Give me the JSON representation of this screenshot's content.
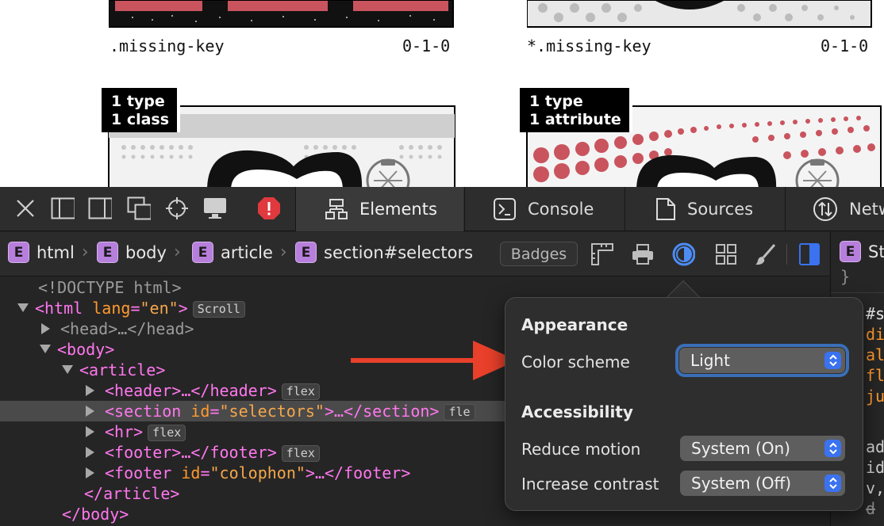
{
  "page": {
    "card1_label": ".missing-key",
    "card1_score": "0-1-0",
    "card2_label": "*.missing-key",
    "card2_score": "0-1-0",
    "card3_badge_line1": "1 type",
    "card3_badge_line2": "1 class",
    "card4_badge_line1": "1 type",
    "card4_badge_line2": "1 attribute"
  },
  "toolbar": {
    "tabs": [
      {
        "label": "Elements",
        "icon": "elements-icon"
      },
      {
        "label": "Console",
        "icon": "console-icon"
      },
      {
        "label": "Sources",
        "icon": "sources-icon"
      },
      {
        "label": "Netw",
        "icon": "network-icon"
      }
    ]
  },
  "breadcrumb": {
    "badge": "E",
    "items": [
      "html",
      "body",
      "article",
      "section#selectors"
    ],
    "badges_button": "Badges"
  },
  "dom": {
    "doctype": "<!DOCTYPE html>",
    "html_open": "<html",
    "html_attr": "lang",
    "html_val": "\"en\"",
    "html_close": ">",
    "html_pill": "Scroll",
    "head": "<head>…</head>",
    "body_open": "<body>",
    "article_open": "<article>",
    "header": "<header>…</header>",
    "header_pill": "flex",
    "section_open": "<section",
    "section_attr": "id",
    "section_val": "\"selectors\"",
    "section_rest": ">…</section>",
    "section_pill": "fle",
    "hr": "<hr>",
    "hr_pill": "flex",
    "footer": "<footer>…</footer>",
    "footer_pill": "flex",
    "footer2_open": "<footer",
    "footer2_attr": "id",
    "footer2_val": "\"colophon\"",
    "footer2_rest": ">…</footer>",
    "article_close": "</article>",
    "body_close": "</body>"
  },
  "sidebar": {
    "badge": "E",
    "title": "St",
    "brace": "}",
    "lines": [
      "#s",
      "di",
      "al",
      "fl",
      "ju"
    ],
    "lines2": [
      "ad",
      "id",
      "v,",
      "d"
    ]
  },
  "popover": {
    "appearance_heading": "Appearance",
    "color_scheme_label": "Color scheme",
    "color_scheme_value": "Light",
    "accessibility_heading": "Accessibility",
    "reduce_motion_label": "Reduce motion",
    "reduce_motion_value": "System (On)",
    "increase_contrast_label": "Increase contrast",
    "increase_contrast_value": "System (Off)"
  },
  "colors": {
    "accent": "#3a72f0",
    "annotation_arrow": "#e8402a",
    "element_badge": "#b77fdc",
    "tag": "#ff77ee",
    "attribute_value": "#f5a74a"
  }
}
